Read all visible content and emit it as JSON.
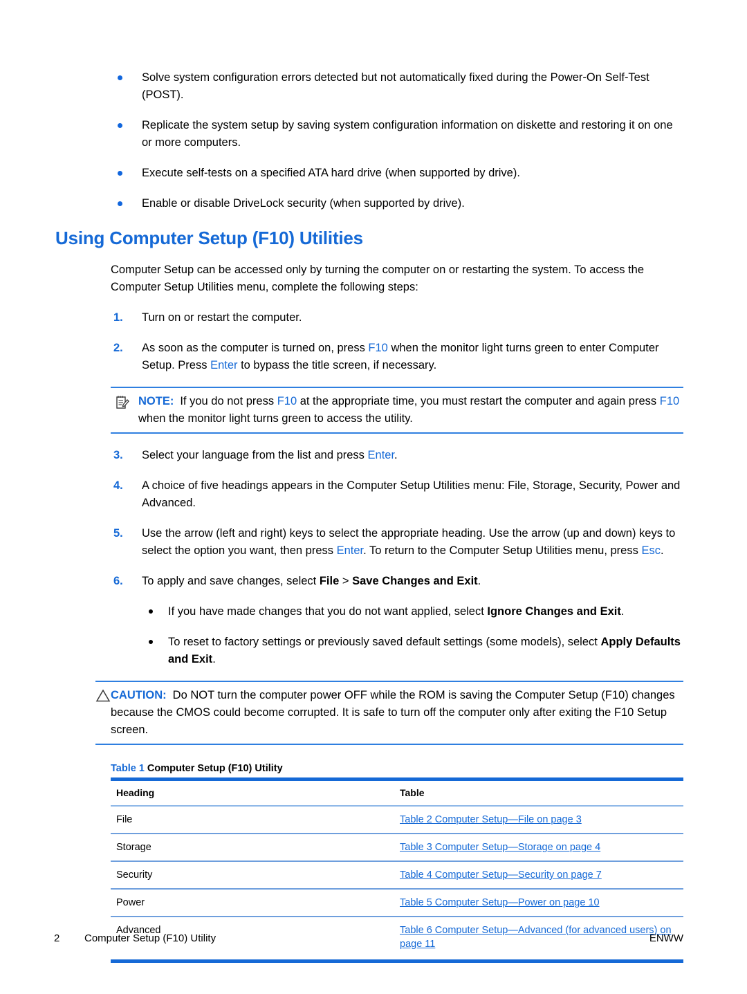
{
  "doc": {
    "top_bullets": [
      "Solve system configuration errors detected but not automatically fixed during the Power-On Self-Test (POST).",
      "Replicate the system setup by saving system configuration information on diskette and restoring it on one or more computers.",
      "Execute self-tests on a specified ATA hard drive (when supported by drive).",
      "Enable or disable DriveLock security (when supported by drive)."
    ],
    "heading": "Using Computer Setup (F10) Utilities",
    "intro": "Computer Setup can be accessed only by turning the computer on or restarting the system. To access the Computer Setup Utilities menu, complete the following steps:",
    "steps": {
      "n1": "1.",
      "n2": "2.",
      "n3": "3.",
      "n4": "4.",
      "n5": "5.",
      "n6": "6.",
      "s1_text": "Turn on or restart the computer.",
      "s2_a": "As soon as the computer is turned on, press ",
      "s2_key1": "F10",
      "s2_b": " when the monitor light turns green to enter Computer Setup. Press ",
      "s2_key2": "Enter",
      "s2_c": " to bypass the title screen, if necessary.",
      "s3_a": "Select your language from the list and press ",
      "s3_key1": "Enter",
      "s3_b": ".",
      "s4_text": "A choice of five headings appears in the Computer Setup Utilities menu: File, Storage, Security, Power and Advanced.",
      "s5_a": "Use the arrow (left and right) keys to select the appropriate heading. Use the arrow (up and down) keys to select the option you want, then press ",
      "s5_key1": "Enter",
      "s5_b": ". To return to the Computer Setup Utilities menu, press ",
      "s5_key2": "Esc",
      "s5_c": ".",
      "s6_a": "To apply and save changes, select ",
      "s6_bold1": "File",
      "s6_b": " > ",
      "s6_bold2": "Save Changes and Exit",
      "s6_c": "."
    },
    "sub_bullets": {
      "b1_a": "If you have made changes that you do not want applied, select ",
      "b1_bold": "Ignore Changes and Exit",
      "b1_b": ".",
      "b2_a": "To reset to factory settings or previously saved default settings (some models), select ",
      "b2_bold": "Apply Defaults and Exit",
      "b2_b": "."
    },
    "note": {
      "label": "NOTE:",
      "icon": "note-icon",
      "a": "If you do not press ",
      "key1": "F10",
      "b": " at the appropriate time, you must restart the computer and again press ",
      "key2": "F10",
      "c": " when the monitor light turns green to access the utility."
    },
    "caution": {
      "label": "CAUTION:",
      "icon": "warning-triangle-icon",
      "text": "Do NOT turn the computer power OFF while the ROM is saving the Computer Setup (F10) changes because the CMOS could become corrupted. It is safe to turn off the computer only after exiting the F10 Setup screen."
    },
    "table": {
      "caption_number": "Table 1",
      "caption_title": "Computer Setup (F10) Utility",
      "columns": [
        "Heading",
        "Table"
      ],
      "rows": [
        {
          "heading": "File",
          "link": "Table 2 Computer Setup—File on page 3"
        },
        {
          "heading": "Storage",
          "link": "Table 3 Computer Setup—Storage on page 4"
        },
        {
          "heading": "Security",
          "link": "Table 4 Computer Setup—Security on page 7"
        },
        {
          "heading": "Power",
          "link": "Table 5 Computer Setup—Power on page 10"
        },
        {
          "heading": "Advanced",
          "link": "Table 6 Computer Setup—Advanced (for advanced users) on page 11"
        }
      ]
    },
    "footer": {
      "page_number": "2",
      "title": "Computer Setup (F10) Utility",
      "right": "ENWW"
    },
    "colors": {
      "accent_blue": "#1569d6",
      "rule_blue": "#2f7fe0",
      "bullet_blue": "#1166dd"
    }
  }
}
